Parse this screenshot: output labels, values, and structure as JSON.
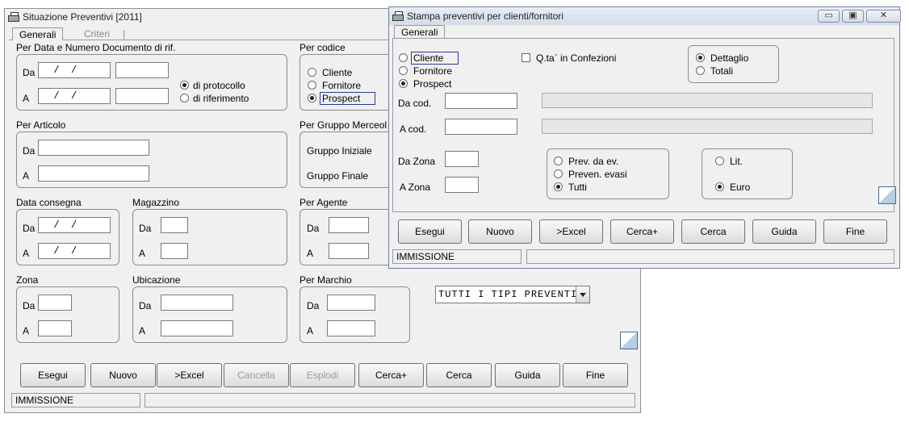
{
  "main_window": {
    "title": "Situazione Preventivi [2011]",
    "tabs": {
      "generali": "Generali",
      "criteri": "Criteri",
      "sep": "|"
    },
    "per_data": {
      "title": "Per Data e Numero Documento di rif.",
      "da": "Da",
      "a": "A",
      "date_da": "  /  /",
      "date_a": "  /  /",
      "opt_protocollo": "di protocollo",
      "opt_riferimento": "di riferimento"
    },
    "per_codice": {
      "title": "Per codice",
      "cliente": "Cliente",
      "fornitore": "Fornitore",
      "prospect": "Prospect"
    },
    "per_articolo": {
      "title": "Per Articolo",
      "da": "Da",
      "a": "A"
    },
    "per_gruppo": {
      "title": "Per Gruppo Merceol",
      "iniziale": "Gruppo Iniziale",
      "finale": "Gruppo Finale"
    },
    "data_consegna": {
      "title": "Data consegna",
      "da": "Da",
      "a": "A",
      "date_da": "  /  /",
      "date_a": "  /  /"
    },
    "magazzino": {
      "title": "Magazzino",
      "da": "Da",
      "a": "A"
    },
    "per_agente": {
      "title": "Per Agente",
      "da": "Da",
      "a": "A"
    },
    "zona": {
      "title": "Zona",
      "da": "Da",
      "a": "A"
    },
    "ubicazione": {
      "title": "Ubicazione",
      "da": "Da",
      "a": "A"
    },
    "per_marchio": {
      "title": "Per Marchio",
      "da": "Da",
      "a": "A"
    },
    "tipo_preventivi": "TUTTI I TIPI PREVENTI",
    "buttons": {
      "esegui": "Esegui",
      "nuovo": "Nuovo",
      "excel": ">Excel",
      "cancella": "Cancella",
      "esplodi": "Esplodi",
      "cerca_plus": "Cerca+",
      "cerca": "Cerca",
      "guida": "Guida",
      "fine": "Fine"
    },
    "status": "IMMISSIONE"
  },
  "print_window": {
    "title": "Stampa preventivi per clienti/fornitori",
    "controls": {
      "minimize": "▭",
      "maximize": "▣",
      "close": "✕"
    },
    "tab": "Generali",
    "tipo": {
      "cliente": "Cliente",
      "fornitore": "Fornitore",
      "prospect": "Prospect"
    },
    "qta_confezioni": "Q.ta` in Confezioni",
    "modo": {
      "dettaglio": "Dettaglio",
      "totali": "Totali"
    },
    "da_cod": "Da cod.",
    "a_cod": "A cod.",
    "da_zona": "Da Zona",
    "a_zona": "A Zona",
    "stato": {
      "da_ev": "Prev. da ev.",
      "evasi": "Preven. evasi",
      "tutti": "Tutti"
    },
    "valuta": {
      "lit": "Lit.",
      "euro": "Euro"
    },
    "buttons": {
      "esegui": "Esegui",
      "nuovo": "Nuovo",
      "excel": ">Excel",
      "cerca_plus": "Cerca+",
      "cerca": "Cerca",
      "guida": "Guida",
      "fine": "Fine"
    },
    "status": "IMMISSIONE"
  }
}
